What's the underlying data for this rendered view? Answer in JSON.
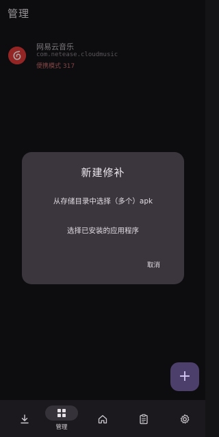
{
  "header": {
    "title": "管理"
  },
  "app_list": [
    {
      "name": "网易云音乐",
      "package": "com.netease.cloudmusic",
      "status": "便携模式 317",
      "icon": "netease-music-icon"
    }
  ],
  "dialog": {
    "title": "新建修补",
    "option_1": "从存储目录中选择（多个）apk",
    "option_2": "选择已安装的应用程序",
    "cancel": "取消"
  },
  "fab": {
    "label": "+",
    "icon": "add-icon"
  },
  "bottom_nav": {
    "items": [
      {
        "icon": "download-icon",
        "label": ""
      },
      {
        "icon": "grid-icon",
        "label": "管理",
        "selected": true
      },
      {
        "icon": "home-icon",
        "label": ""
      },
      {
        "icon": "clipboard-icon",
        "label": ""
      },
      {
        "icon": "gear-icon",
        "label": ""
      }
    ]
  },
  "colors": {
    "background": "#141316",
    "dialog": "#3b363d",
    "accent": "#4d3f6b",
    "status_text": "#c86b6b",
    "app_icon": "#e23a3a"
  }
}
